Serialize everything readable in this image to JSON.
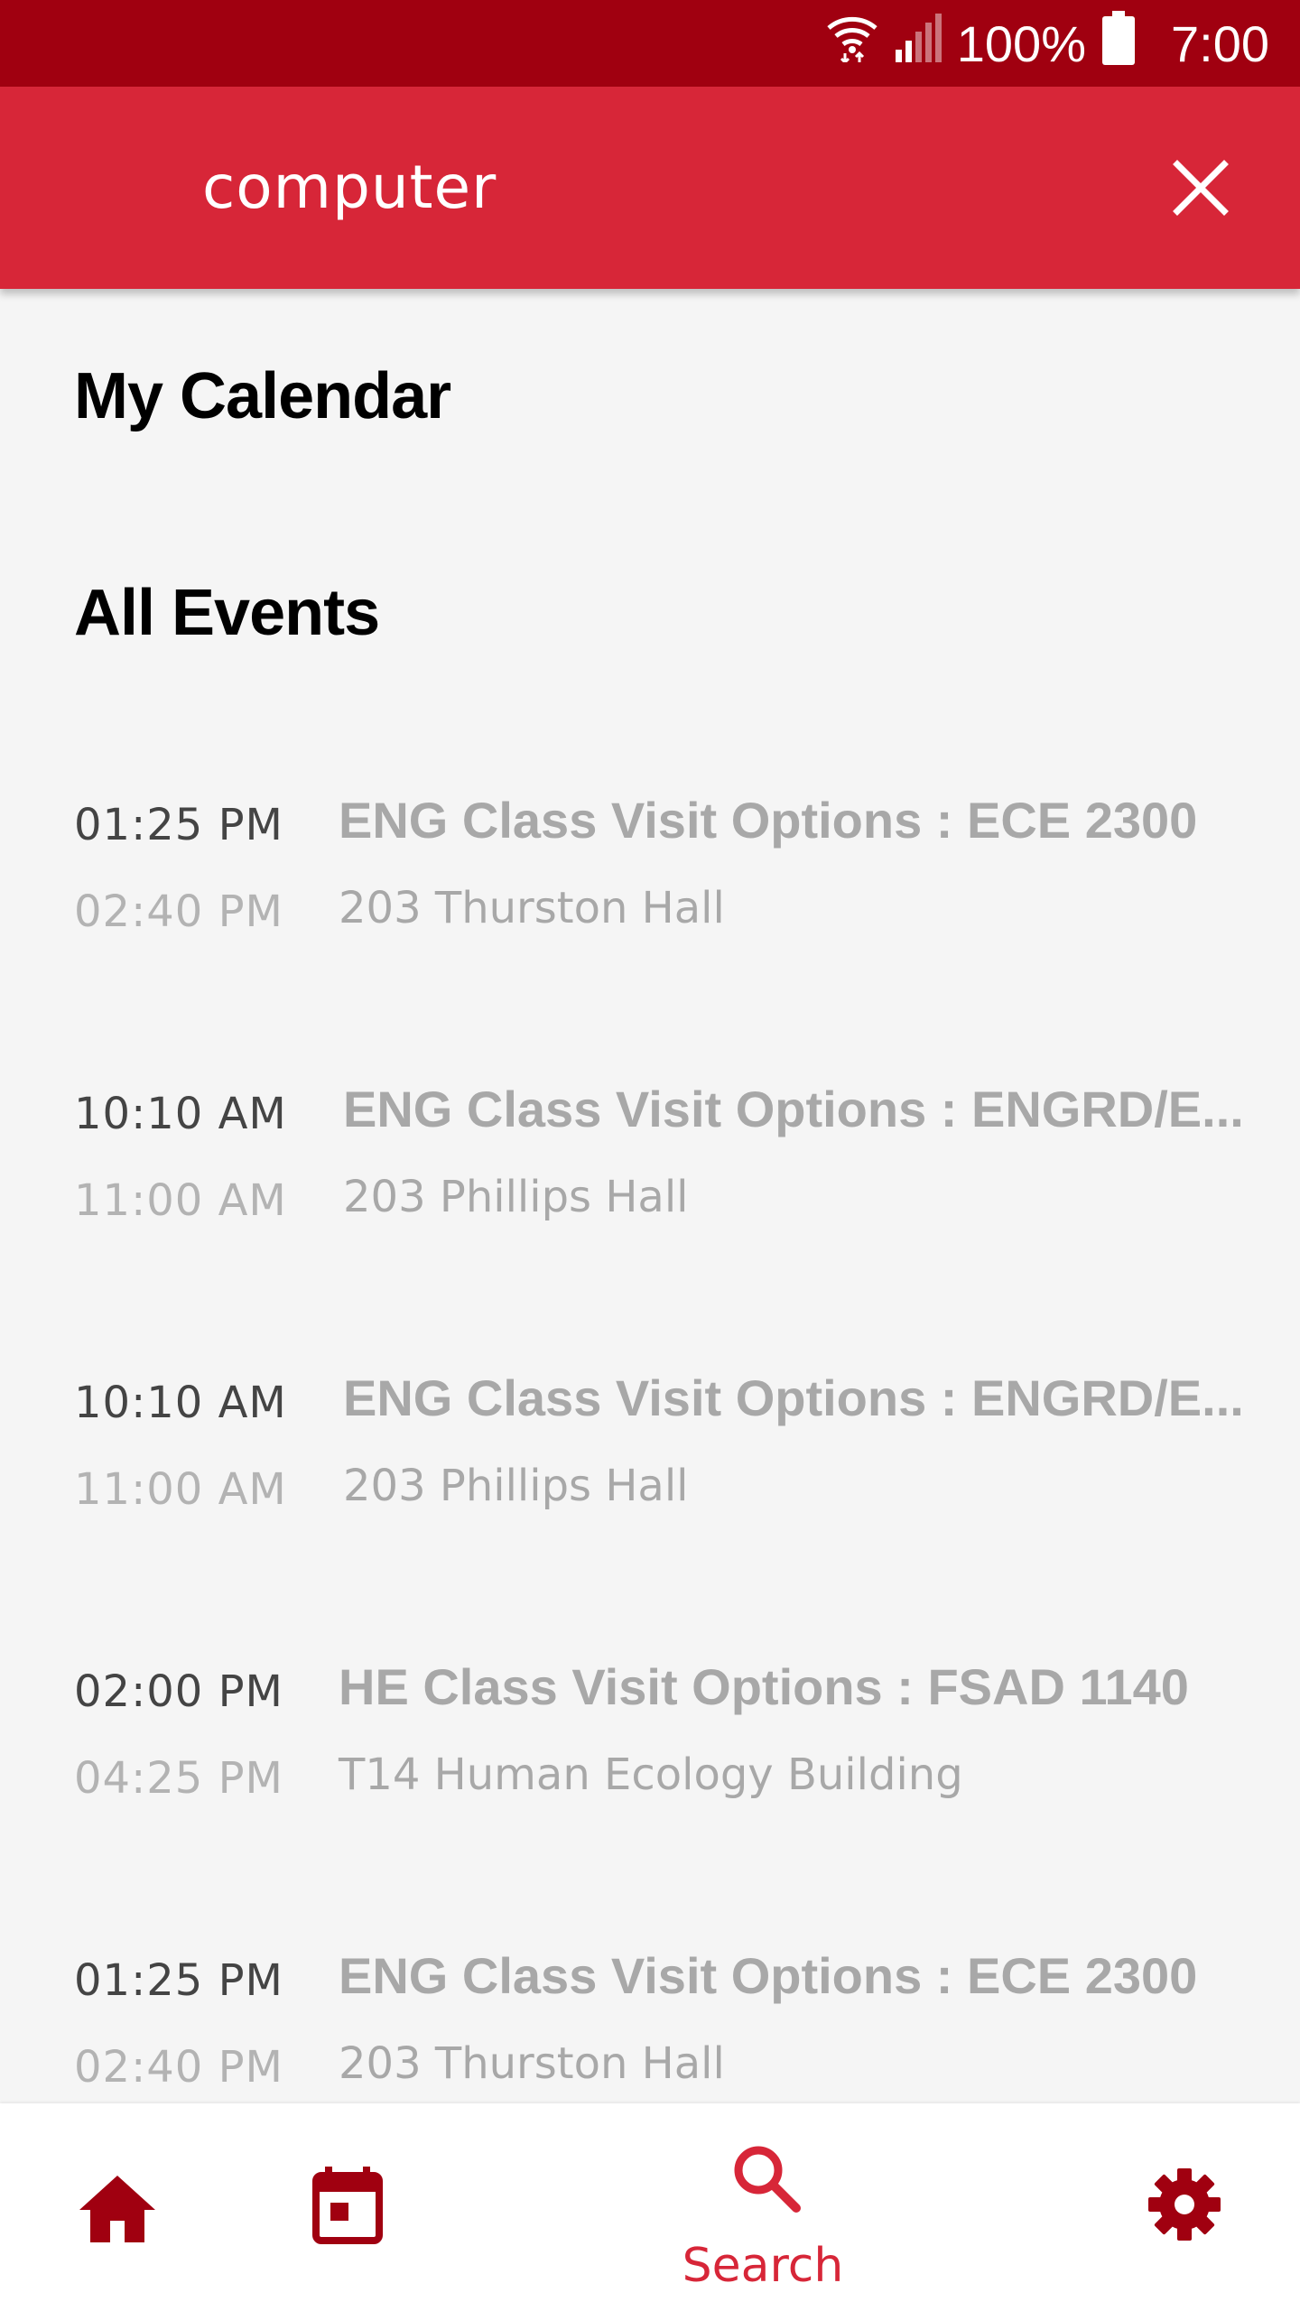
{
  "status_bar": {
    "battery_percent": "100%",
    "time": "7:00",
    "icons": [
      "wifi-icon",
      "signal-icon",
      "battery-icon"
    ]
  },
  "search": {
    "query": "computer",
    "close_icon": "close-icon"
  },
  "sections": {
    "my_calendar": "My Calendar",
    "all_events": "All Events"
  },
  "events": [
    {
      "start": "01:25 PM",
      "end": "02:40 PM",
      "title": "ENG Class Visit Options : ECE 2300",
      "location": "203 Thurston Hall"
    },
    {
      "start": "10:10 AM",
      "end": "11:00 AM",
      "title": "ENG Class Visit Options : ENGRD/E...",
      "location": "203 Phillips Hall"
    },
    {
      "start": "10:10 AM",
      "end": "11:00 AM",
      "title": "ENG Class Visit Options : ENGRD/E...",
      "location": "203 Phillips Hall"
    },
    {
      "start": "02:00 PM",
      "end": "04:25 PM",
      "title": "HE Class Visit Options : FSAD 1140",
      "location": "T14 Human Ecology Building"
    },
    {
      "start": "01:25 PM",
      "end": "02:40 PM",
      "title": "ENG Class Visit Options : ECE 2300",
      "location": "203 Thurston Hall"
    }
  ],
  "bottom_nav": {
    "home_icon": "home-icon",
    "calendar_icon": "calendar-icon",
    "search_icon": "search-icon",
    "search_label": "Search",
    "settings_icon": "gear-icon"
  },
  "colors": {
    "status_bar": "#a00010",
    "app_bar": "#d72638",
    "accent": "#d72638",
    "nav_icon": "#a00010"
  }
}
